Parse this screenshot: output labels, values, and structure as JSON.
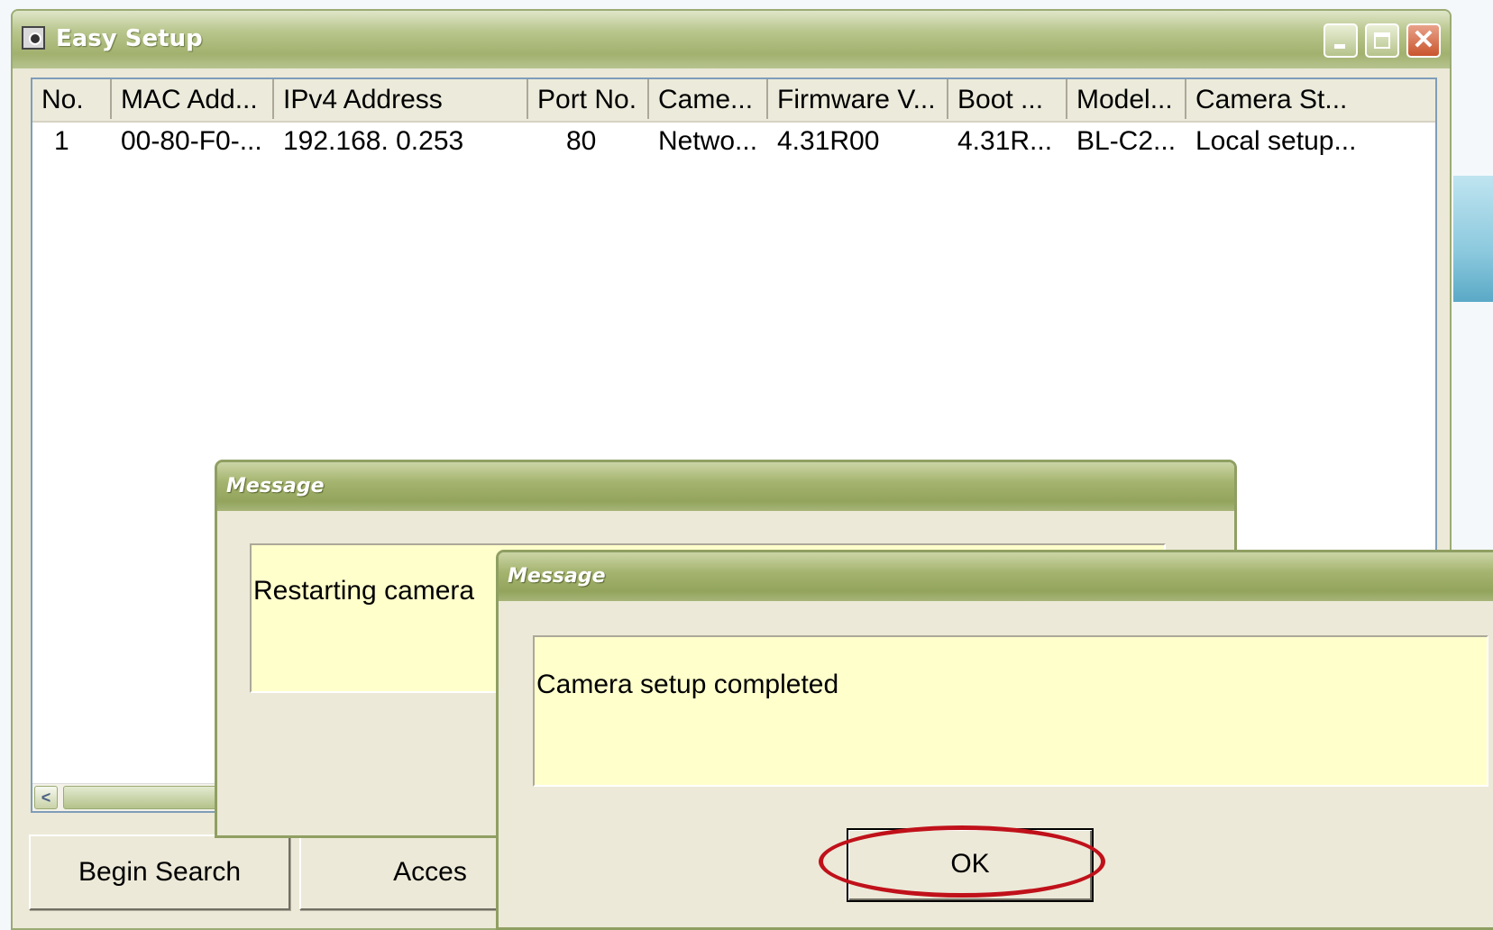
{
  "main_window": {
    "title": "Easy Setup",
    "columns": [
      "No.",
      "MAC Add...",
      "IPv4 Address",
      "Port No.",
      "Came...",
      "Firmware V...",
      "Boot ...",
      "Model...",
      "Camera St..."
    ],
    "rows": [
      [
        "1",
        "00-80-F0-...",
        "192.168.  0.253",
        "80",
        "Netwo...",
        "4.31R00",
        "4.31R...",
        "BL-C2...",
        "Local setup..."
      ]
    ],
    "buttons": {
      "begin_search": "Begin Search",
      "access": "Acces"
    }
  },
  "dialog_restart": {
    "title": "Message",
    "message": "Restarting camera"
  },
  "dialog_complete": {
    "title": "Message",
    "message": "Camera setup completed",
    "ok_label": "OK"
  },
  "icons": {
    "app": "camera-icon",
    "minimize": "minimize-icon",
    "maximize": "maximize-icon",
    "close": "close-icon",
    "scroll_left": "chevron-left-icon"
  },
  "colors": {
    "titlebar": "#a2b16e",
    "message_background": "#ffffcc",
    "highlight": "#c0111a"
  }
}
